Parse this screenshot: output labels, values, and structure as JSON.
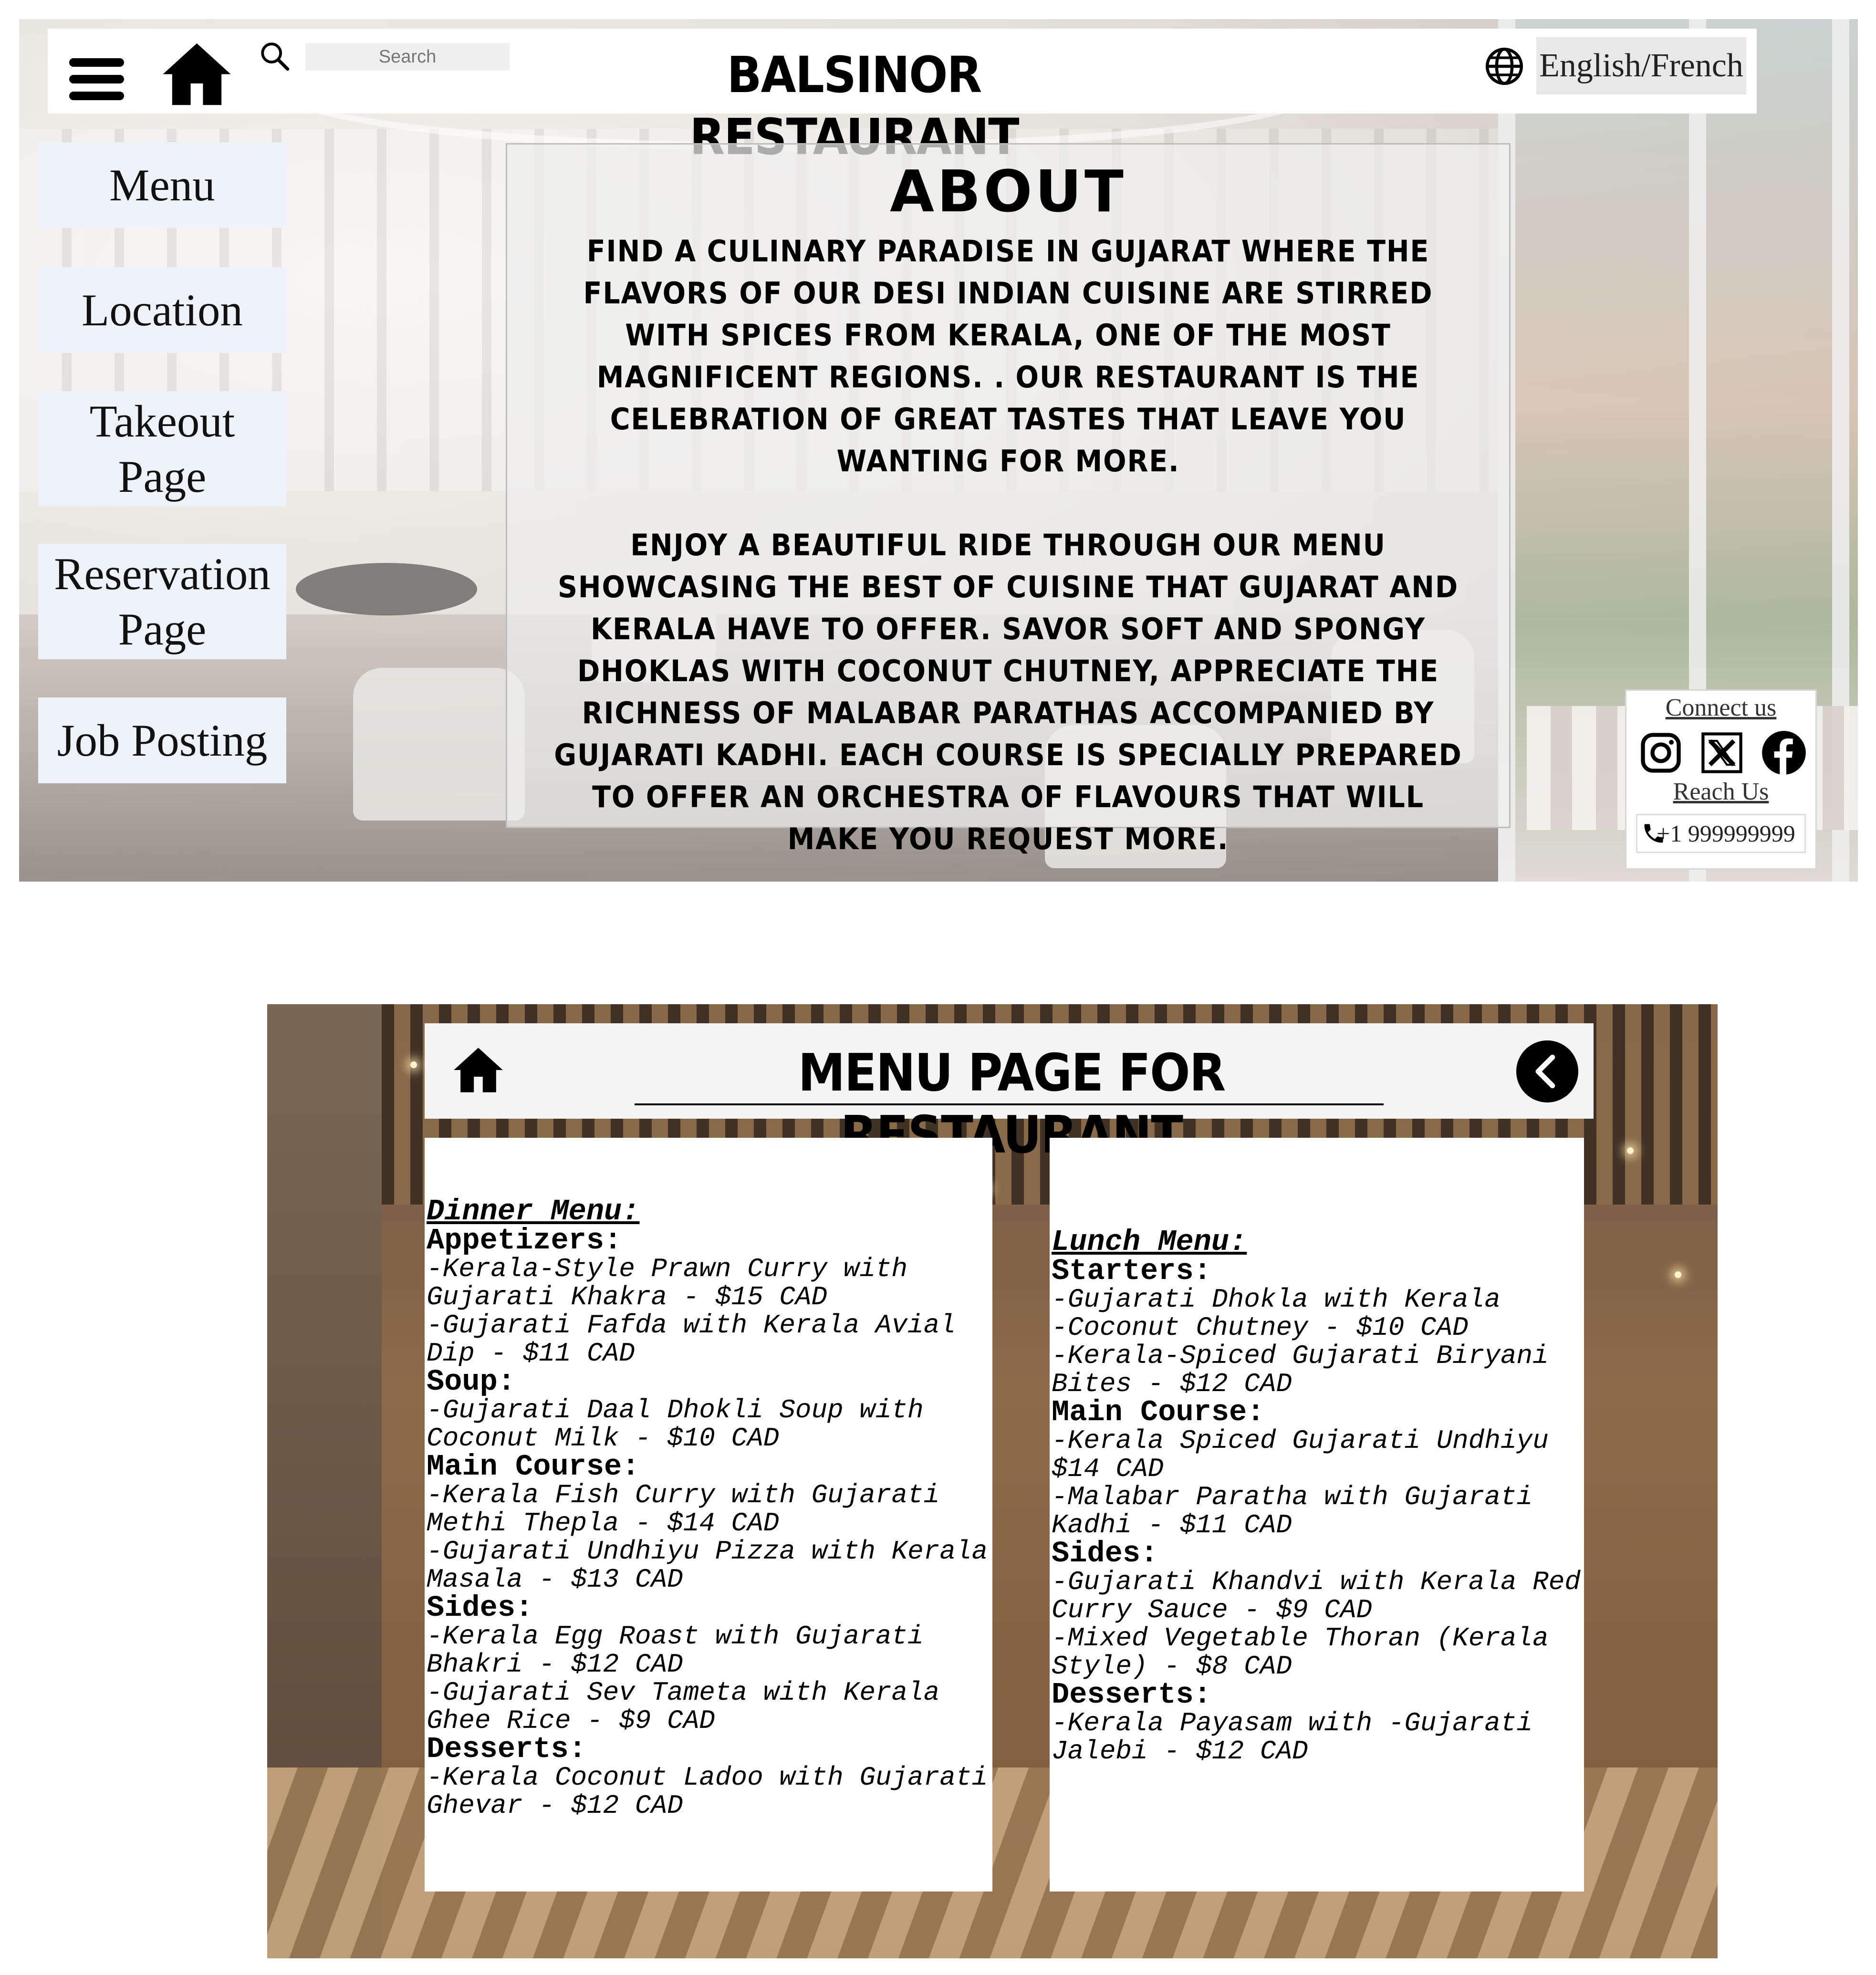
{
  "header": {
    "search_placeholder": "Search",
    "title": "BALSINOR RESTAURANT",
    "language_label": "English/French"
  },
  "nav": {
    "items": [
      {
        "label": "Menu"
      },
      {
        "label": "Location"
      },
      {
        "label": "Takeout Page"
      },
      {
        "label": "Reservation Page"
      },
      {
        "label": "Job Posting"
      }
    ]
  },
  "about": {
    "title": "ABOUT",
    "paragraph1": "FIND A CULINARY PARADISE IN GUJARAT WHERE THE FLAVORS OF OUR DESI INDIAN CUISINE ARE STIRRED WITH SPICES FROM KERALA, ONE OF THE MOST MAGNIFICENT REGIONS. . OUR RESTAURANT IS THE CELEBRATION OF GREAT TASTES THAT LEAVE YOU WANTING FOR MORE.",
    "paragraph2": "ENJOY A BEAUTIFUL RIDE THROUGH OUR MENU SHOWCASING THE BEST OF CUISINE THAT GUJARAT AND KERALA HAVE TO OFFER. SAVOR SOFT AND SPONGY DHOKLAS WITH COCONUT CHUTNEY, APPRECIATE THE RICHNESS OF MALABAR PARATHAS ACCOMPANIED BY GUJARATI KADHI. EACH COURSE IS SPECIALLY PREPARED TO OFFER AN ORCHESTRA OF FLAVOURS THAT WILL MAKE YOU REQUEST MORE."
  },
  "contact": {
    "connect_label": "Connect us",
    "reach_label": "Reach Us",
    "phone": "+1 999999999",
    "social_icons": [
      "instagram-icon",
      "x-twitter-icon",
      "facebook-icon"
    ]
  },
  "menu_page": {
    "title": "MENU PAGE FOR RESTAURANT",
    "dinner": {
      "heading": "Dinner Menu:",
      "sections": [
        {
          "name": "Appetizers:",
          "items": [
            "-Kerala-Style Prawn Curry with Gujarati Khakra - $15 CAD",
            "-Gujarati Fafda with Kerala Avial Dip - $11 CAD"
          ]
        },
        {
          "name": "Soup:",
          "items": [
            "-Gujarati Daal Dhokli Soup with Coconut Milk - $10 CAD"
          ]
        },
        {
          "name": "Main Course:",
          "items": [
            "-Kerala Fish Curry with Gujarati Methi Thepla - $14 CAD",
            "-Gujarati Undhiyu Pizza with Kerala Masala - $13 CAD"
          ]
        },
        {
          "name": "Sides:",
          "items": [
            "-Kerala Egg Roast with Gujarati Bhakri - $12 CAD",
            "-Gujarati Sev Tameta with Kerala Ghee Rice - $9 CAD"
          ]
        },
        {
          "name": "Desserts:",
          "items": [
            "-Kerala Coconut Ladoo with Gujarati Ghevar - $12 CAD"
          ]
        }
      ]
    },
    "lunch": {
      "heading": "Lunch Menu:",
      "sections": [
        {
          "name": "Starters:",
          "items": [
            "-Gujarati Dhokla with Kerala",
            "-Coconut Chutney - $10 CAD",
            "-Kerala-Spiced Gujarati Biryani Bites - $12 CAD"
          ]
        },
        {
          "name": "Main Course:",
          "items": [
            "-Kerala Spiced Gujarati Undhiyu $14 CAD",
            "-Malabar Paratha with Gujarati Kadhi - $11 CAD"
          ]
        },
        {
          "name": "Sides:",
          "items": [
            "-Gujarati Khandvi with Kerala Red Curry Sauce - $9 CAD",
            "-Mixed Vegetable Thoran (Kerala Style) - $8 CAD"
          ]
        },
        {
          "name": "Desserts:",
          "items": [
            "-Kerala Payasam with -Gujarati Jalebi - $12 CAD"
          ]
        }
      ]
    }
  }
}
